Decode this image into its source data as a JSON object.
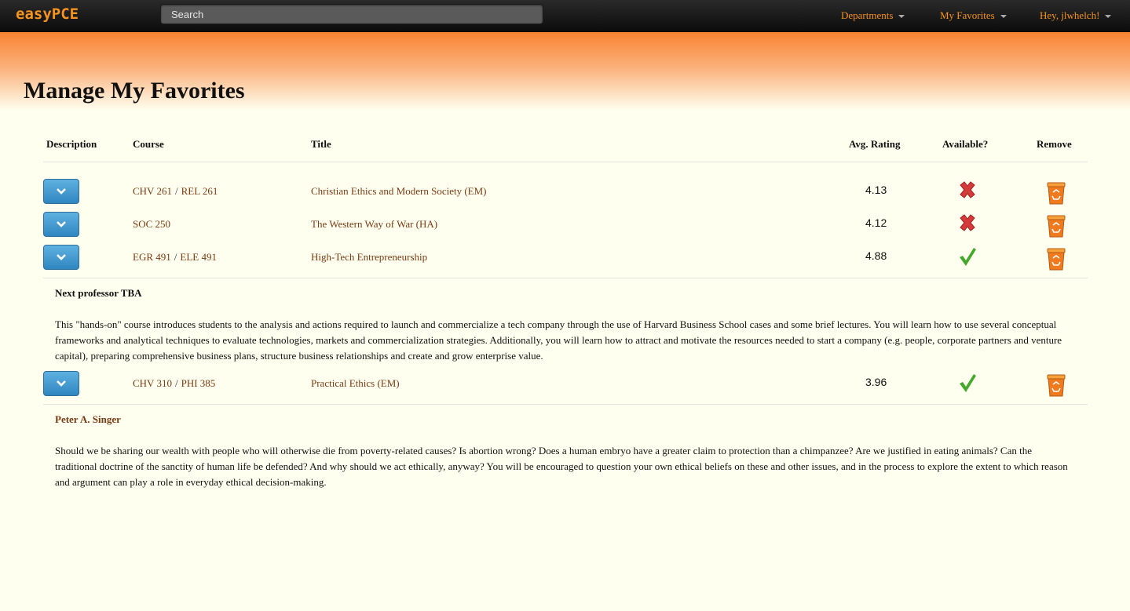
{
  "navbar": {
    "brand_part1": "easy",
    "brand_part2": "PCE",
    "search_placeholder": "Search",
    "links": [
      "Departments",
      "My Favorites",
      "Hey, jlwhelch!"
    ]
  },
  "page": {
    "title": "Manage My Favorites"
  },
  "table": {
    "headers": [
      "Description",
      "Course",
      "Title",
      "Avg. Rating",
      "Available?",
      "Remove"
    ],
    "rows": [
      {
        "courses": [
          "CHV 261",
          "REL 261"
        ],
        "title": "Christian Ethics and Modern Society (EM)",
        "rating": "4.13",
        "available": false
      },
      {
        "courses": [
          "SOC 250"
        ],
        "title": "The Western Way of War (HA)",
        "rating": "4.12",
        "available": false
      },
      {
        "courses": [
          "EGR 491",
          "ELE 491"
        ],
        "title": "High-Tech Entrepreneurship",
        "rating": "4.88",
        "available": true,
        "professor": "Next professor TBA",
        "description": "This \"hands-on\" course introduces students to the analysis and actions required to launch and commercialize a tech company through the use of Harvard Business School cases and some brief lectures. You will learn how to use several conceptual frameworks and analytical techniques to evaluate technologies, markets and commercialization strategies. Additionally, you will learn how to attract and motivate the resources needed to start a company (e.g. people, corporate partners and venture capital), preparing comprehensive business plans, structure business relationships and create and grow enterprise value."
      },
      {
        "courses": [
          "CHV 310",
          "PHI 385"
        ],
        "title": "Practical Ethics (EM)",
        "rating": "3.96",
        "available": true,
        "professor": "Peter A. Singer",
        "description": "Should we be sharing our wealth with people who will otherwise die from poverty-related causes? Is abortion wrong? Does a human embryo have a greater claim to protection than a chimpanzee? Are we justified in eating animals? Can the traditional doctrine of the sanctity of human life be defended? And why should we act ethically, anyway? You will be encouraged to question your own ethical beliefs on these and other issues, and in the process to explore the extent to which reason and argument can play a role in everyday ethical decision-making."
      }
    ]
  },
  "colors": {
    "accent": "#f7931e",
    "link": "#7a3a12",
    "button": "#2f86c0",
    "available_yes": "#3aa61c",
    "available_no": "#d03030"
  },
  "icons": {
    "expand": "chevron-down-icon",
    "unavailable": "x-mark-icon",
    "available": "check-mark-icon",
    "remove": "recycle-bin-icon"
  }
}
